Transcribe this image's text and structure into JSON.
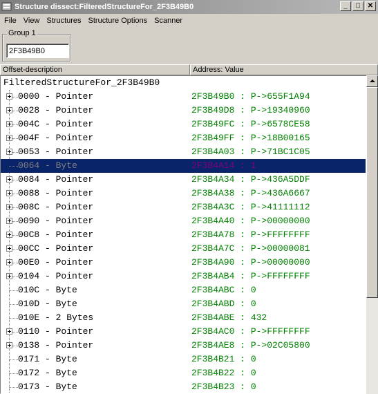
{
  "window": {
    "title": "Structure dissect:FilteredStructureFor_2F3B49B0",
    "minimize_glyph": "_",
    "maximize_glyph": "□",
    "close_glyph": "✕"
  },
  "menu": [
    "File",
    "View",
    "Structures",
    "Structure Options",
    "Scanner"
  ],
  "group": {
    "label": "Group 1",
    "address_value": "2F3B49B0"
  },
  "columns": {
    "offset": "Offset-description",
    "address": "Address: Value"
  },
  "tree": {
    "root": "FilteredStructureFor_2F3B49B0",
    "rows": [
      {
        "offset": "0000 - Pointer",
        "value": "2F3B49B0 : P->655F1A94",
        "expandable": true
      },
      {
        "offset": "0028 - Pointer",
        "value": "2F3B49D8 : P->19340960",
        "expandable": true
      },
      {
        "offset": "004C - Pointer",
        "value": "2F3B49FC : P->6578CE58",
        "expandable": true
      },
      {
        "offset": "004F - Pointer",
        "value": "2F3B49FF : P->18B00165",
        "expandable": true
      },
      {
        "offset": "0053 - Pointer",
        "value": "2F3B4A03 : P->71BC1C05",
        "expandable": true
      },
      {
        "offset": "0064 - Byte",
        "value": "2F3B4A14 : 1",
        "expandable": false,
        "selected": true
      },
      {
        "offset": "0084 - Pointer",
        "value": "2F3B4A34 : P->436A5DDF",
        "expandable": true
      },
      {
        "offset": "0088 - Pointer",
        "value": "2F3B4A38 : P->436A6667",
        "expandable": true
      },
      {
        "offset": "008C - Pointer",
        "value": "2F3B4A3C : P->41111112",
        "expandable": true
      },
      {
        "offset": "0090 - Pointer",
        "value": "2F3B4A40 : P->00000000",
        "expandable": true
      },
      {
        "offset": "00C8 - Pointer",
        "value": "2F3B4A78 : P->FFFFFFFF",
        "expandable": true
      },
      {
        "offset": "00CC - Pointer",
        "value": "2F3B4A7C : P->00000081",
        "expandable": true
      },
      {
        "offset": "00E0 - Pointer",
        "value": "2F3B4A90 : P->00000000",
        "expandable": true
      },
      {
        "offset": "0104 - Pointer",
        "value": "2F3B4AB4 : P->FFFFFFFF",
        "expandable": true
      },
      {
        "offset": "010C - Byte",
        "value": "2F3B4ABC : 0",
        "expandable": false
      },
      {
        "offset": "010D - Byte",
        "value": "2F3B4ABD : 0",
        "expandable": false
      },
      {
        "offset": "010E - 2 Bytes",
        "value": "2F3B4ABE : 432",
        "expandable": false
      },
      {
        "offset": "0110 - Pointer",
        "value": "2F3B4AC0 : P->FFFFFFFF",
        "expandable": true
      },
      {
        "offset": "0138 - Pointer",
        "value": "2F3B4AE8 : P->02C05800",
        "expandable": true
      },
      {
        "offset": "0171 - Byte",
        "value": "2F3B4B21 : 0",
        "expandable": false
      },
      {
        "offset": "0172 - Byte",
        "value": "2F3B4B22 : 0",
        "expandable": false
      },
      {
        "offset": "0173 - Byte",
        "value": "2F3B4B23 : 0",
        "expandable": false
      }
    ]
  },
  "colors": {
    "title_gradient_start": "#808080",
    "value_green": "#008000",
    "selection_bg": "#0a246a",
    "selection_value": "#800080"
  }
}
